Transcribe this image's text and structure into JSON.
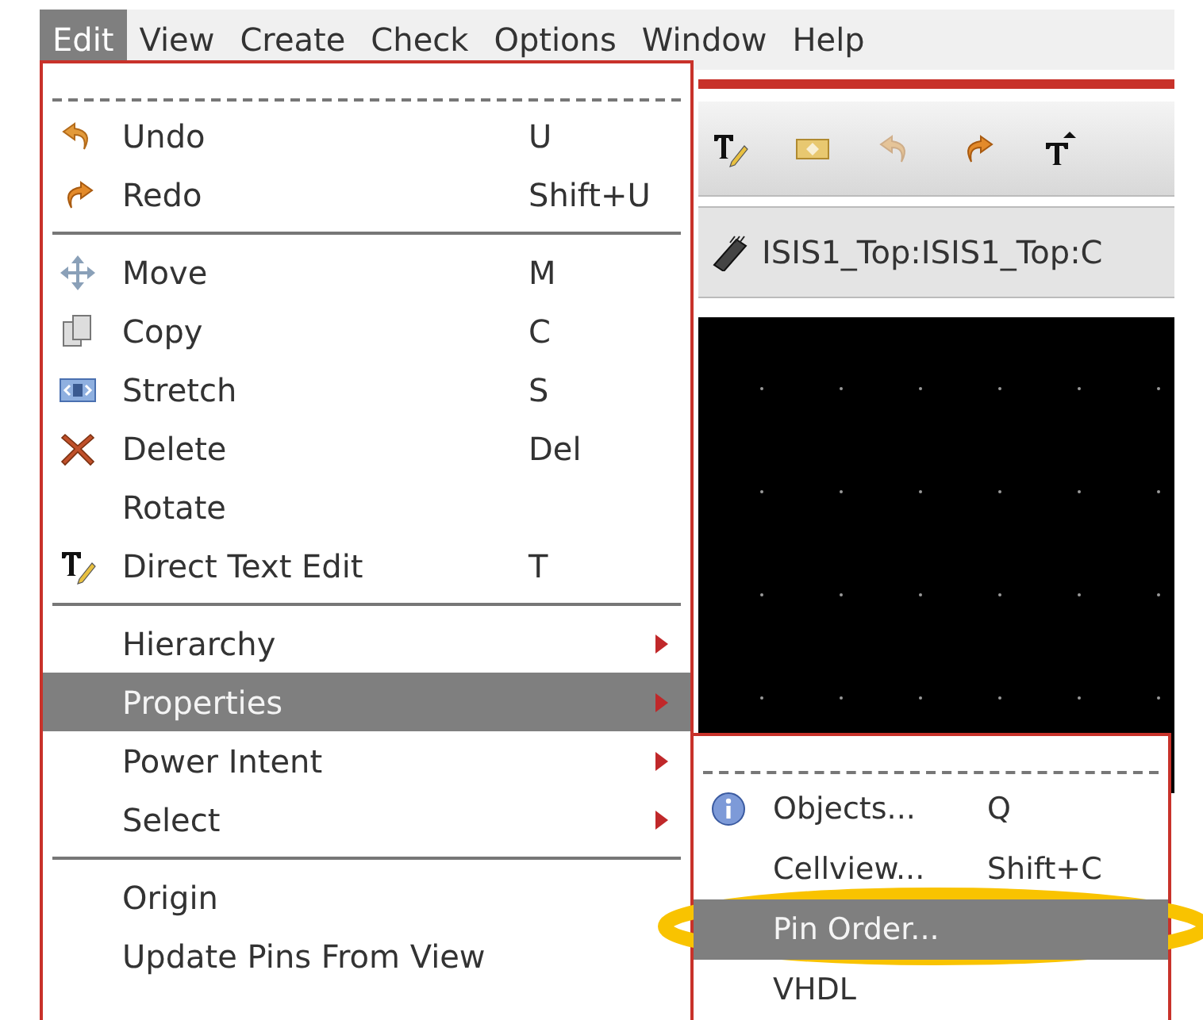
{
  "menubar": [
    {
      "label": "Edit",
      "selected": true
    },
    {
      "label": "View",
      "selected": false
    },
    {
      "label": "Create",
      "selected": false
    },
    {
      "label": "Check",
      "selected": false
    },
    {
      "label": "Options",
      "selected": false
    },
    {
      "label": "Window",
      "selected": false
    },
    {
      "label": "Help",
      "selected": false
    }
  ],
  "path_bar": {
    "text": "ISIS1_Top:ISIS1_Top:C"
  },
  "edit_menu": [
    {
      "kind": "tearoff"
    },
    {
      "kind": "item",
      "label": "Undo",
      "shortcut": "U",
      "selected": false,
      "submenu": false
    },
    {
      "kind": "item",
      "label": "Redo",
      "shortcut": "Shift+U",
      "selected": false,
      "submenu": false
    },
    {
      "kind": "separator"
    },
    {
      "kind": "item",
      "label": "Move",
      "shortcut": "M",
      "selected": false,
      "submenu": false
    },
    {
      "kind": "item",
      "label": "Copy",
      "shortcut": "C",
      "selected": false,
      "submenu": false
    },
    {
      "kind": "item",
      "label": "Stretch",
      "shortcut": "S",
      "selected": false,
      "submenu": false
    },
    {
      "kind": "item",
      "label": "Delete",
      "shortcut": "Del",
      "selected": false,
      "submenu": false
    },
    {
      "kind": "item",
      "label": "Rotate",
      "selected": false,
      "submenu": false
    },
    {
      "kind": "item",
      "label": "Direct Text Edit",
      "shortcut": "T",
      "selected": false,
      "submenu": false
    },
    {
      "kind": "separator"
    },
    {
      "kind": "item",
      "label": "Hierarchy",
      "selected": false,
      "submenu": true
    },
    {
      "kind": "item",
      "label": "Properties",
      "selected": true,
      "submenu": true
    },
    {
      "kind": "item",
      "label": "Power Intent",
      "selected": false,
      "submenu": true
    },
    {
      "kind": "item",
      "label": "Select",
      "selected": false,
      "submenu": true
    },
    {
      "kind": "separator"
    },
    {
      "kind": "item",
      "label": "Origin",
      "selected": false,
      "submenu": false
    },
    {
      "kind": "item",
      "label": "Update Pins From View",
      "selected": false,
      "submenu": false
    }
  ],
  "properties_submenu": [
    {
      "kind": "tearoff"
    },
    {
      "kind": "item",
      "label": "Objects...",
      "shortcut": "Q",
      "selected": false
    },
    {
      "kind": "item",
      "label": "Cellview...",
      "shortcut": "Shift+C",
      "selected": false
    },
    {
      "kind": "item",
      "label": "Pin Order...",
      "selected": true
    },
    {
      "kind": "item",
      "label": "VHDL",
      "selected": false
    }
  ]
}
